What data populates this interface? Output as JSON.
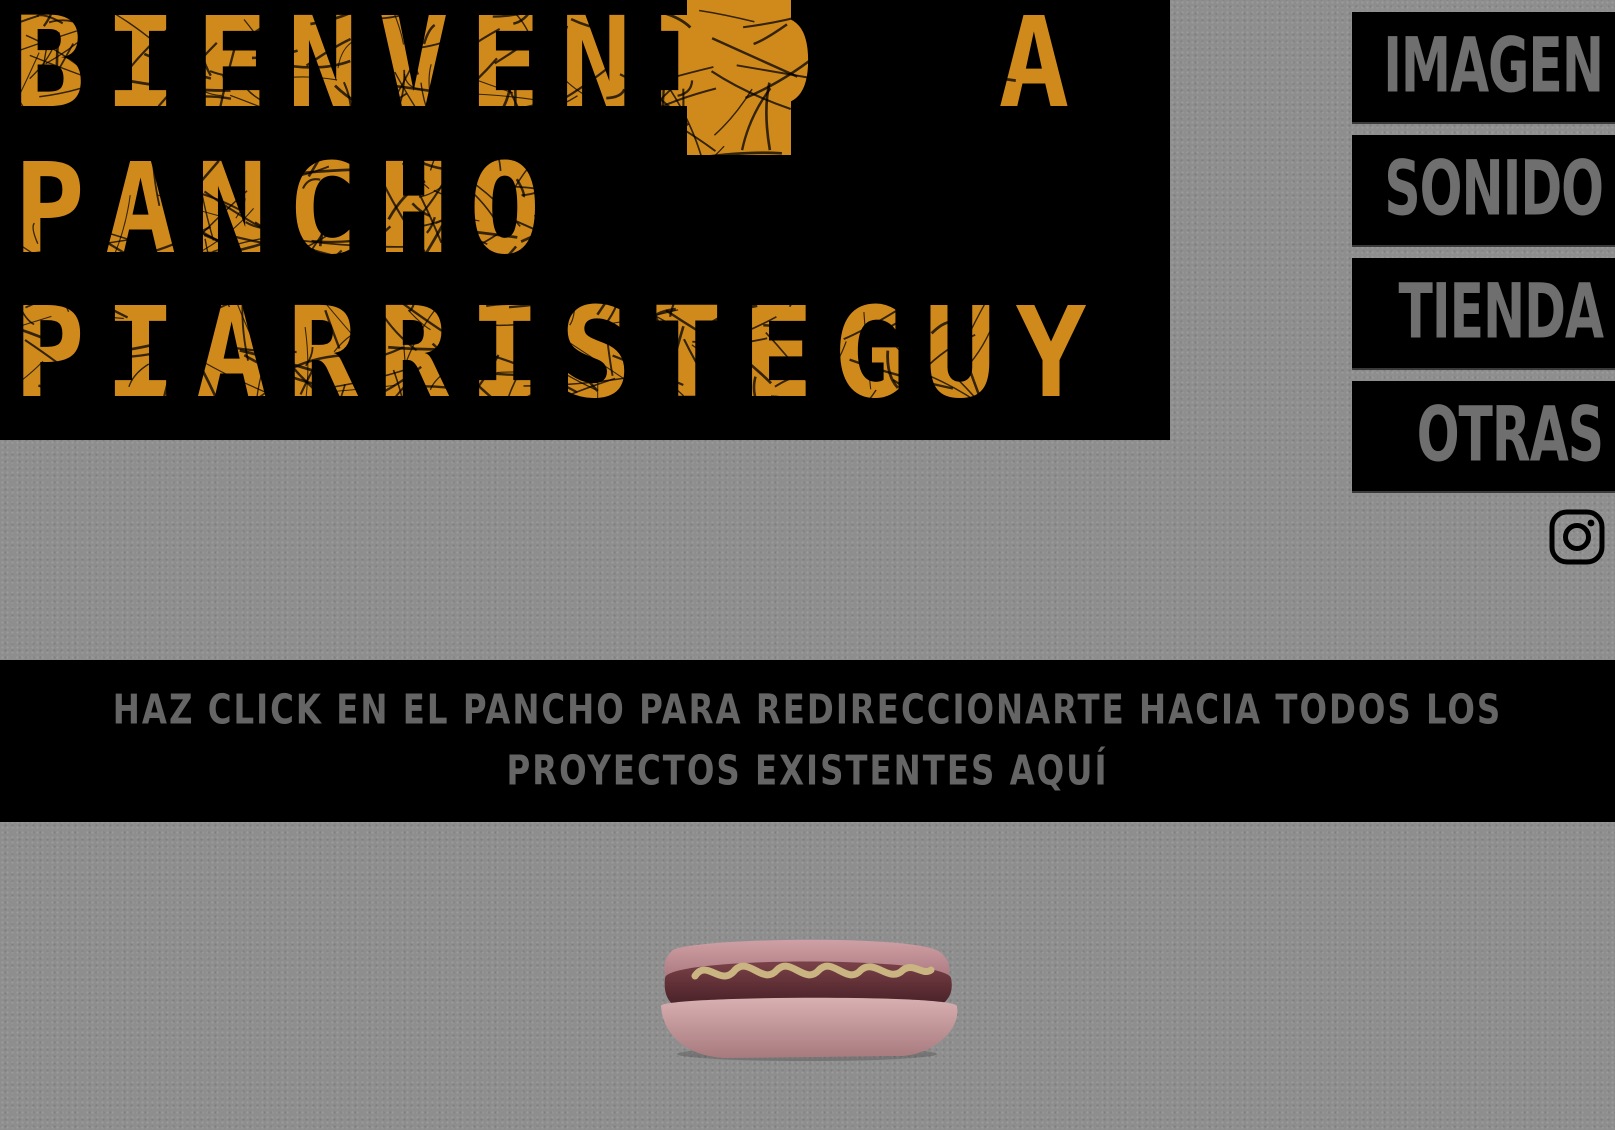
{
  "hero": {
    "line1": "BIENVENID",
    "line1_end": "A",
    "line2": "PANCHO",
    "line3": "PIARRISTEGUY"
  },
  "nav": {
    "items": [
      {
        "label": "IMAGEN"
      },
      {
        "label": "SONIDO"
      },
      {
        "label": "TIENDA"
      },
      {
        "label": "OTRAS"
      }
    ]
  },
  "social": {
    "icon": "instagram-icon"
  },
  "banner": {
    "text": "HAZ CLICK EN EL PANCHO PARA REDIRECCIONARTE HACIA TODOS LOS PROYECTOS EXISTENTES AQUÍ"
  },
  "colors": {
    "background": "#8e8e8e",
    "panel": "#000000",
    "accent": "#d08a1c",
    "nav_text": "#6f6f6f",
    "banner_text": "#656565"
  }
}
